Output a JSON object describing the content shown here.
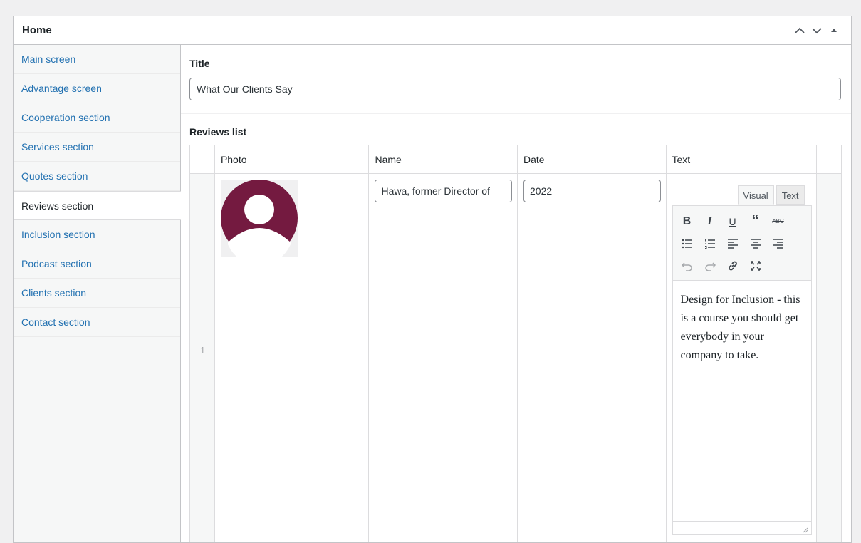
{
  "panel": {
    "title": "Home"
  },
  "sidebar": {
    "items": [
      {
        "label": "Main screen"
      },
      {
        "label": "Advantage screen"
      },
      {
        "label": "Cooperation section"
      },
      {
        "label": "Services section"
      },
      {
        "label": "Quotes section"
      },
      {
        "label": "Reviews section"
      },
      {
        "label": "Inclusion section"
      },
      {
        "label": "Podcast section"
      },
      {
        "label": "Clients section"
      },
      {
        "label": "Contact section"
      }
    ],
    "active_index": 5
  },
  "main": {
    "title_label": "Title",
    "title_value": "What Our Clients Say",
    "reviews_label": "Reviews list",
    "columns": [
      "Photo",
      "Name",
      "Date",
      "Text"
    ],
    "rows": [
      {
        "index": "1",
        "name": "Hawa, former Director of",
        "date": "2022",
        "text": "Design for Inclusion - this is a course you should get everybody in your company to take."
      }
    ]
  },
  "editor": {
    "tab_visual": "Visual",
    "tab_text": "Text"
  },
  "colors": {
    "link": "#2271b1",
    "avatar_bg": "#741a40"
  }
}
